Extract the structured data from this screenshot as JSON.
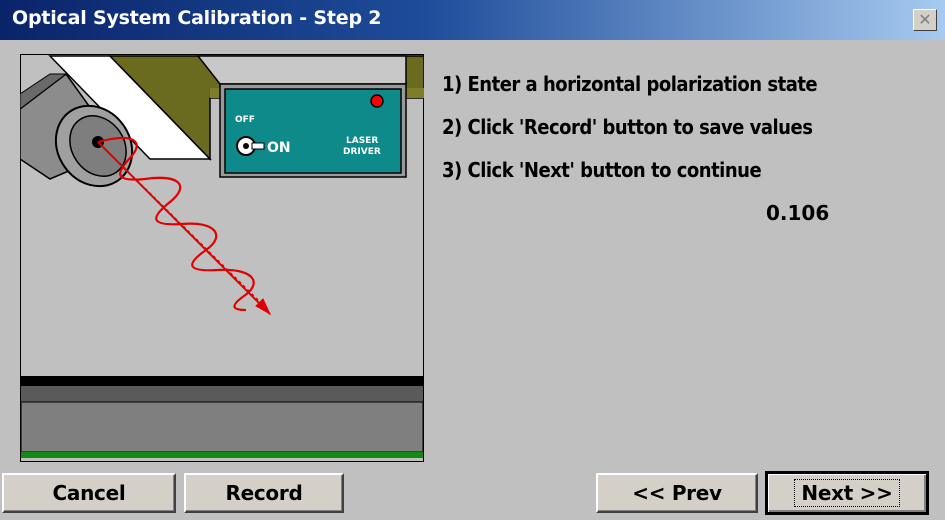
{
  "window": {
    "title": "Optical System Calibration - Step 2",
    "close_symbol": "✕"
  },
  "illustration": {
    "switch_off_label": "OFF",
    "switch_on_label": "ON",
    "driver_label_line1": "LASER",
    "driver_label_line2": "DRIVER",
    "colors": {
      "panel": "#0e8a8a",
      "beam": "#e00000",
      "table": "#6b6b1f",
      "indicator": "#ff0000"
    }
  },
  "instructions": [
    "1) Enter a horizontal polarization state",
    "2) Click 'Record' button to save values",
    "3) Click 'Next' button to continue"
  ],
  "reading": "0.106",
  "buttons": {
    "cancel": "Cancel",
    "record": "Record",
    "prev": "<< Prev",
    "next": "Next >>"
  }
}
